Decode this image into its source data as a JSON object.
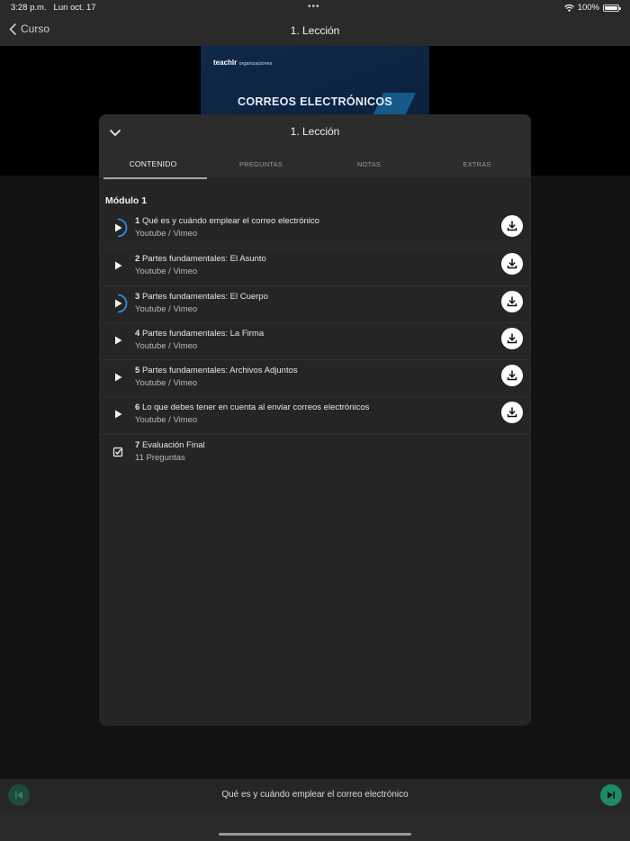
{
  "status_bar": {
    "time": "3:28 p.m.",
    "date": "Lun oct. 17",
    "battery": "100%",
    "wifi_icon": "wifi-icon",
    "battery_level": 1.0
  },
  "nav": {
    "back_label": "Curso",
    "title": "1. Lección"
  },
  "video": {
    "brand": "teachlr",
    "brand_sub": "organizaciones",
    "headline": "CORREOS ELECTRÓNICOS"
  },
  "modal": {
    "title": "1. Lección",
    "tabs": [
      {
        "label": "CONTENIDO",
        "active": true
      },
      {
        "label": "PREGUNTAS",
        "active": false
      },
      {
        "label": "NOTAS",
        "active": false
      },
      {
        "label": "EXTRAS",
        "active": false
      }
    ],
    "module_title": "Módulo 1",
    "items": [
      {
        "num": "1",
        "title": "Qué es y cuándo emplear el correo electrónico",
        "subtitle": "Youtube / Vimeo",
        "type": "video",
        "in_progress": true,
        "downloadable": true
      },
      {
        "num": "2",
        "title": "Partes fundamentales: El Asunto",
        "subtitle": "Youtube / Vimeo",
        "type": "video",
        "in_progress": false,
        "downloadable": true
      },
      {
        "num": "3",
        "title": "Partes fundamentales: El Cuerpo",
        "subtitle": "Youtube / Vimeo",
        "type": "video",
        "in_progress": true,
        "downloadable": true
      },
      {
        "num": "4",
        "title": "Partes fundamentales: La Firma",
        "subtitle": "Youtube / Vimeo",
        "type": "video",
        "in_progress": false,
        "downloadable": true
      },
      {
        "num": "5",
        "title": "Partes fundamentales: Archivos Adjuntos",
        "subtitle": "Youtube / Vimeo",
        "type": "video",
        "in_progress": false,
        "downloadable": true
      },
      {
        "num": "6",
        "title": "Lo que debes tener en cuenta al enviar correos electrónicos",
        "subtitle": "Youtube / Vimeo",
        "type": "video",
        "in_progress": false,
        "downloadable": true
      },
      {
        "num": "7",
        "title": "Evaluación Final",
        "subtitle": "11 Preguntas",
        "type": "quiz",
        "in_progress": false,
        "downloadable": false
      }
    ]
  },
  "player": {
    "now_playing": "Qué es y cuándo emplear el correo electrónico"
  },
  "colors": {
    "accent_green": "#1e8a63",
    "progress_blue": "#2e8de0"
  }
}
